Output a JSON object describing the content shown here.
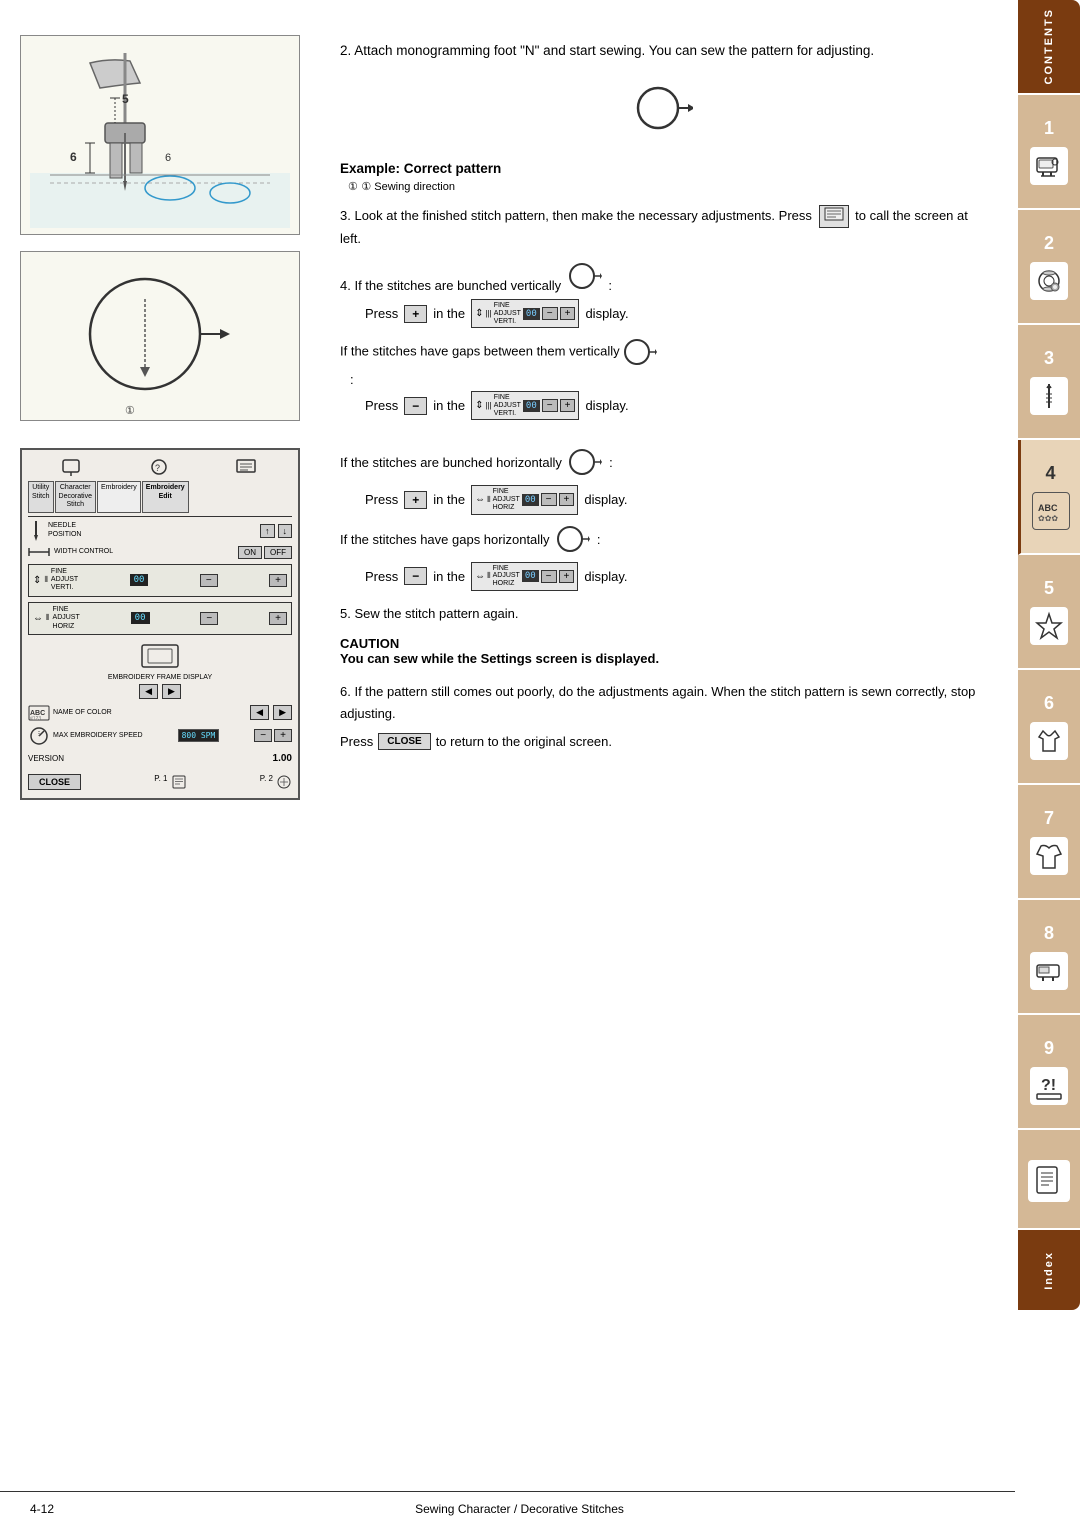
{
  "page": {
    "footer_left": "4-12",
    "footer_center": "Sewing Character / Decorative Stitches",
    "page_num": "P. 1",
    "page_num2": "P. 2"
  },
  "sidebar": {
    "contents_label": "CONTENTS",
    "index_label": "Index",
    "tabs": [
      {
        "number": "1",
        "icon": "sewing-machine-icon"
      },
      {
        "number": "2",
        "icon": "thread-icon"
      },
      {
        "number": "3",
        "icon": "needle-icon"
      },
      {
        "number": "4",
        "icon": "abc-icon"
      },
      {
        "number": "5",
        "icon": "star-icon"
      },
      {
        "number": "6",
        "icon": "shirt-icon"
      },
      {
        "number": "7",
        "icon": "garment-icon"
      },
      {
        "number": "8",
        "icon": "machine2-icon"
      },
      {
        "number": "9",
        "icon": "machine3-icon"
      }
    ]
  },
  "step2": {
    "text": "Attach monogramming foot \"N\" and start sewing. You can sew the pattern for adjusting."
  },
  "example": {
    "title": "Example: Correct pattern",
    "subtitle": "① Sewing direction"
  },
  "step3": {
    "text": "Look at the finished stitch pattern, then make the necessary adjustments. Press",
    "text2": "to call the screen at left."
  },
  "step4": {
    "text_before": "If the stitches are bunched vertically",
    "text_colon": ":",
    "press_label1": "Press",
    "in_the1": "in the",
    "display1": "display.",
    "gap_text": "If the stitches have gaps between them vertically",
    "gap_colon": ":",
    "press_label2": "Press",
    "in_the2": "in the",
    "display2": "display."
  },
  "step4b": {
    "text_before": "If the stitches are bunched horizontally",
    "text_colon": ":",
    "press_label": "Press",
    "in_the": "in the",
    "display": "display.",
    "gap_text": "If the stitches have gaps horizontally",
    "gap_colon": ":",
    "press_label2": "Press",
    "in_the2": "in the",
    "display2": "display."
  },
  "step5": {
    "text": "Sew the stitch pattern again."
  },
  "caution": {
    "title": "CAUTION",
    "body": "You can sew while the Settings screen is displayed."
  },
  "step6": {
    "text": "If the pattern still comes out poorly, do the adjustments again. When the stitch pattern is sewn correctly, stop adjusting.",
    "press_text": "Press",
    "close_label": "CLOSE",
    "return_text": "to return to the original screen."
  },
  "screen": {
    "tabs": [
      "Utility\nStitch",
      "Character\nDecorative\nStitch",
      "Embroidery",
      "Embroidery\nEdit"
    ],
    "needle_label": "NEEDLE\nPOSITION",
    "width_label": "WIDTH\nCONTROL",
    "fine_adj_verti": "FINE\nADJUST\nVERTI.",
    "fine_adj_horiz": "FINE\nADJUST\nHORIZ",
    "embroidery_frame": "EMBROIDERY\nFRAME DISPLAY",
    "name_of_color": "NAME OF\nCOLOR",
    "max_emb_speed": "MAX\nEMBROIDERY\nSPEED",
    "speed_value": "800 SPM",
    "version_label": "VERSION",
    "version_value": "1.00",
    "close_btn": "CLOSE",
    "on_label": "ON",
    "off_label": "OFF"
  },
  "plus_btn": "+",
  "minus_btn": "−"
}
